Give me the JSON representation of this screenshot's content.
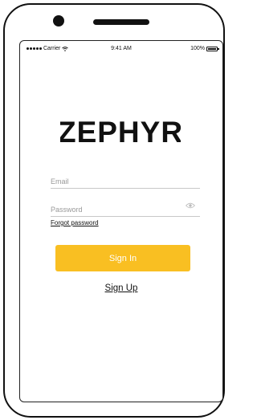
{
  "status_bar": {
    "carrier": "Carrier",
    "time": "9:41 AM",
    "battery": "100%"
  },
  "logo": {
    "text": "ZEPHYR"
  },
  "form": {
    "email_placeholder": "Email",
    "password_placeholder": "Password",
    "forgot_label": "Forgot password"
  },
  "actions": {
    "signin_label": "Sign In",
    "signup_label": "Sign Up"
  },
  "colors": {
    "accent": "#f9bf22",
    "underline": "#c8c8c8"
  },
  "icons": {
    "signal": "signal-dots-icon",
    "wifi": "wifi-icon",
    "battery": "battery-icon",
    "password_visibility": "eye-icon"
  }
}
